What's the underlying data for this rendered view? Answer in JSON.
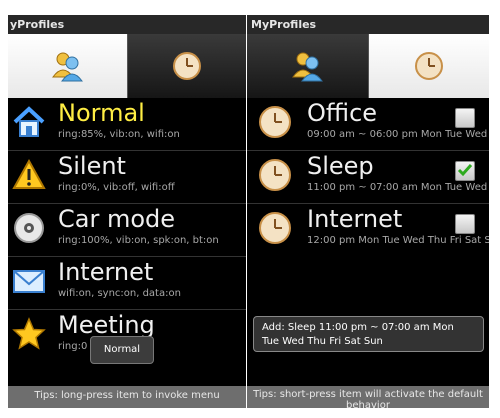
{
  "left": {
    "title": "yProfiles",
    "tabs": [
      {
        "icon": "profiles-people-icon",
        "active": true
      },
      {
        "icon": "clock-icon",
        "active": false
      }
    ],
    "profiles": [
      {
        "name": "Normal",
        "details": "ring:85%, vib:on, wifi:on",
        "icon": "home-icon",
        "selected": true
      },
      {
        "name": "Silent",
        "details": "ring:0%, vib:off, wifi:off",
        "icon": "warning-icon",
        "selected": false
      },
      {
        "name": "Car mode",
        "details": "ring:100%, vib:on, spk:on, bt:on",
        "icon": "disc-icon",
        "selected": false
      },
      {
        "name": "Internet",
        "details": "wifi:on, sync:on, data:on",
        "icon": "envelope-icon",
        "selected": false
      },
      {
        "name": "Meeting",
        "details": "ring:0",
        "icon": "star-icon",
        "selected": false
      }
    ],
    "toast": "Normal",
    "tips": "Tips: long-press item to invoke menu"
  },
  "right": {
    "title": "MyProfiles",
    "tabs": [
      {
        "icon": "profiles-people-icon",
        "active": false
      },
      {
        "icon": "clock-icon",
        "active": true
      }
    ],
    "schedules": [
      {
        "name": "Office",
        "details": "09:00 am ~ 06:00 pm Mon Tue Wed",
        "checked": false
      },
      {
        "name": "Sleep",
        "details": "11:00 pm ~ 07:00 am Mon Tue Wed",
        "checked": true
      },
      {
        "name": "Internet",
        "details": "12:00 pm Mon Tue Wed Thu Fri Sat S",
        "checked": false
      }
    ],
    "popup_line1": "Add:  Sleep 11:00 pm  ~ 07:00 am Mon",
    "popup_line2": "Tue Wed Thu Fri Sat Sun",
    "tips_line1": "Tips: short-press item will activate the default",
    "tips_line2": "behavior"
  },
  "colors": {
    "selected_text": "#ffee44",
    "check_green": "#2eaa1e"
  }
}
